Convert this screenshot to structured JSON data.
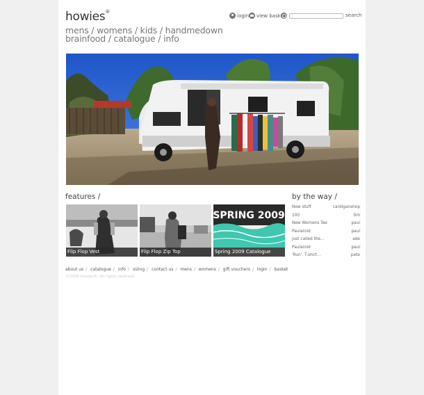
{
  "brand": {
    "logo_text": "howies",
    "reg_mark": "®"
  },
  "utility": {
    "login_label": "login",
    "basket_label": "view basket",
    "search_placeholder": "",
    "search_label": "search"
  },
  "nav": {
    "row1": [
      "mens",
      "womens",
      "kids",
      "handmedown"
    ],
    "row2": [
      "brainfood",
      "catalogue",
      "info"
    ],
    "separator": "/"
  },
  "features": {
    "title": "features /",
    "items": [
      {
        "caption": "Flip Flop Vest"
      },
      {
        "caption": "Flip Flop Zip Top"
      },
      {
        "caption": "Spring 2009 Catalogue",
        "image_text": "SPRING 2009"
      }
    ]
  },
  "by_the_way": {
    "title": "by the way /",
    "rows": [
      {
        "post": "New stuff",
        "author": "cardiganshop"
      },
      {
        "post": "100",
        "author": "tim"
      },
      {
        "post": "New Womens Tee",
        "author": "paul"
      },
      {
        "post": "Paularoid",
        "author": "paul"
      },
      {
        "post": "just called the...",
        "author": "ade"
      },
      {
        "post": "Paularoid",
        "author": "paul"
      },
      {
        "post": "'Run'. T-shirt...",
        "author": "pete"
      }
    ]
  },
  "footer": {
    "links": [
      "about us",
      "catalogue",
      "info",
      "sizing",
      "contact us",
      "mens",
      "womens",
      "gift vouchers",
      "login",
      "basket"
    ],
    "separator": "/",
    "copyright": "©2009 howies®. All rights reserved"
  },
  "colors": {
    "page_bg": "#f0f0f0",
    "content_bg": "#ffffff",
    "caption_bg": "#2a2a2a",
    "catalogue_teal": "#3fc7b0"
  }
}
